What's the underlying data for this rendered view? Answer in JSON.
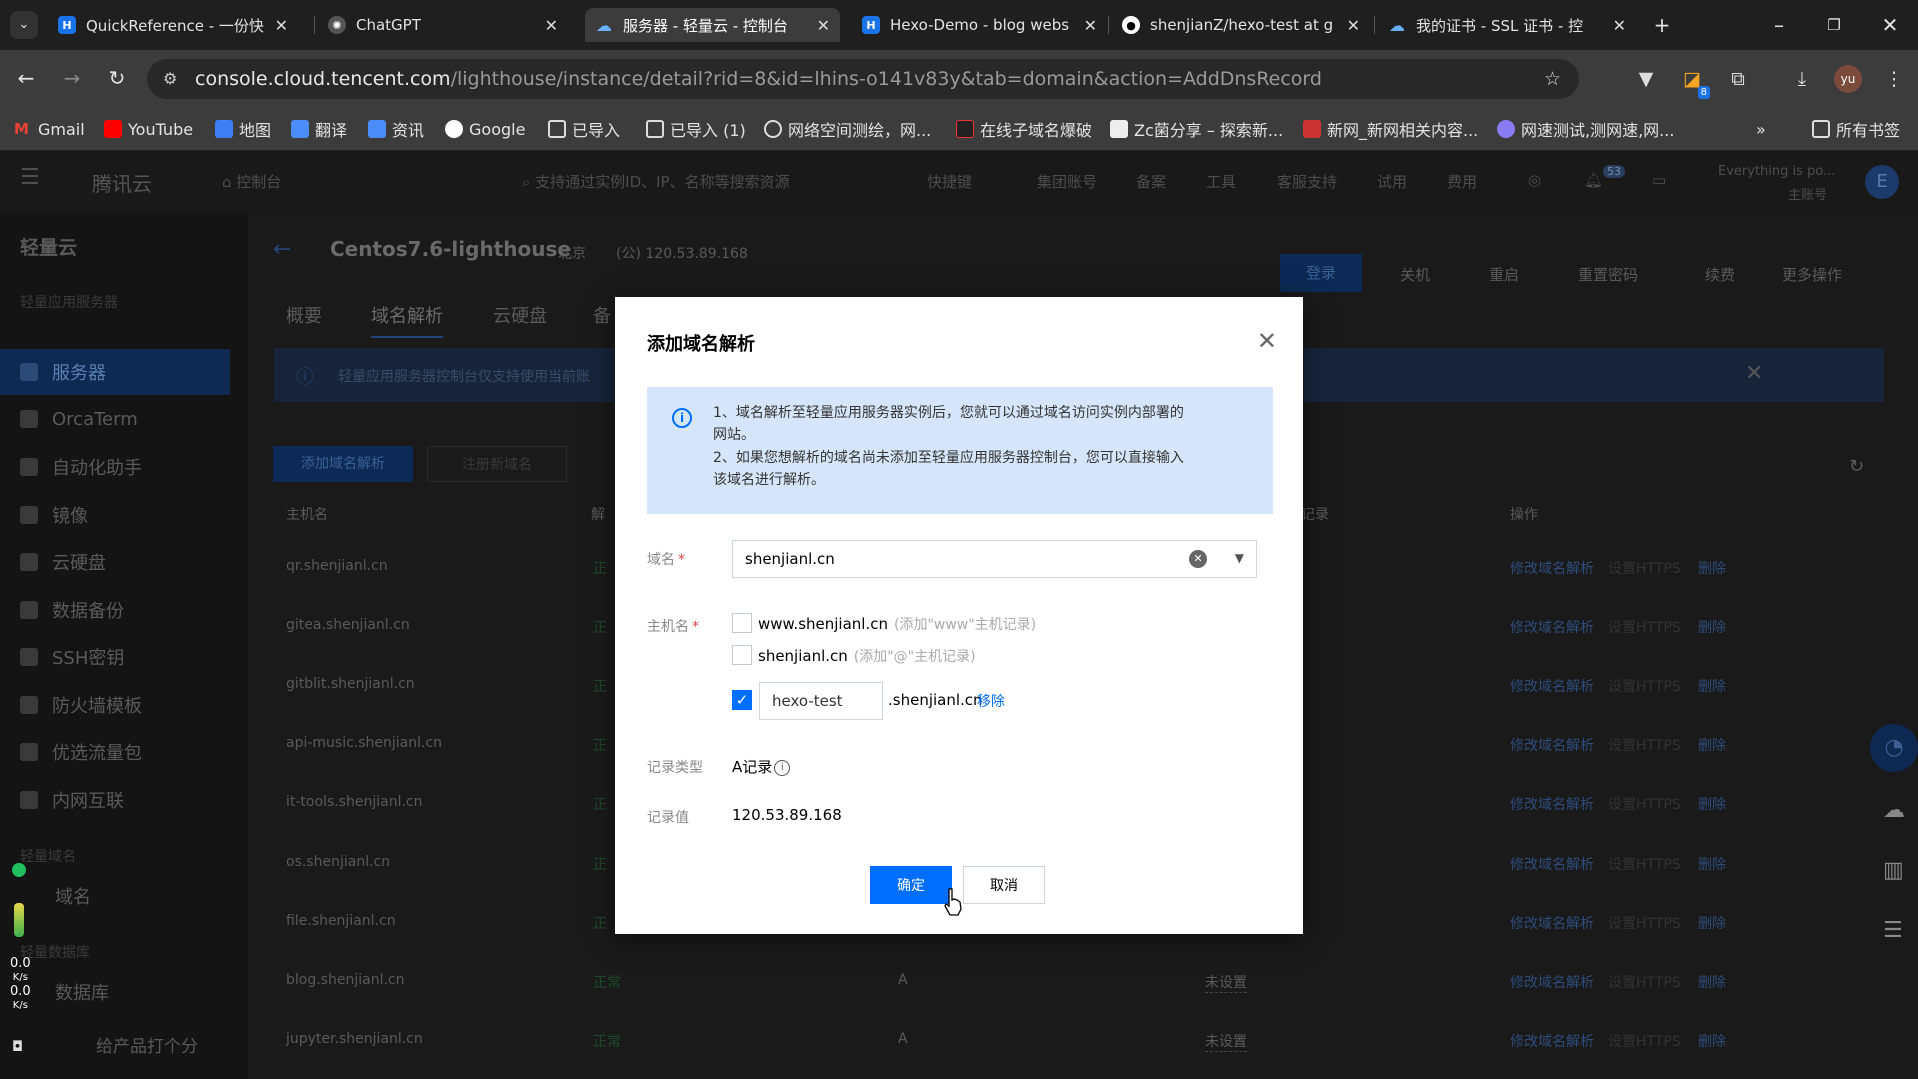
{
  "browser": {
    "tabs": [
      {
        "title": "QuickReference - 一份快",
        "favicon_color": "#1a73e8"
      },
      {
        "title": "ChatGPT",
        "favicon_color": "#777777"
      },
      {
        "title": "服务器 - 轻量云 - 控制台",
        "favicon_color": "#4ea1ff"
      },
      {
        "title": "Hexo-Demo - blog webs",
        "favicon_color": "#1a73e8"
      },
      {
        "title": "shenjianZ/hexo-test at g",
        "favicon_color": "#ffffff"
      },
      {
        "title": "我的证书 - SSL 证书 - 控",
        "favicon_color": "#4ea1ff"
      }
    ],
    "url_host": "console.cloud.tencent.com",
    "url_path": "/lighthouse/instance/detail?rid=8&id=lhins-o141v83y&tab=domain&action=AddDnsRecord",
    "profile_initials": "yu",
    "extension_badge": "8",
    "bookmarks": [
      "Gmail",
      "YouTube",
      "地图",
      "翻译",
      "资讯",
      "Google",
      "已导入",
      "已导入 (1)",
      "网络空间测绘，网...",
      "在线子域名爆破",
      "Zc菌分享 – 探索新...",
      "新网_新网相关内容...",
      "网速测试,测网速,网..."
    ],
    "all_bookmarks": "所有书签"
  },
  "console": {
    "logo": "腾讯云",
    "home": "控制台",
    "search_placeholder": "支持通过实例ID、IP、名称等搜索资源",
    "nav": [
      "快捷键",
      "集团账号",
      "备案",
      "工具",
      "客服支持",
      "试用",
      "费用"
    ],
    "notification_count": "53",
    "account_line1": "Everything is po...",
    "account_line2": "主账号",
    "avatar": "E",
    "sidebar_title": "轻量云",
    "sidebar_section1": "轻量应用服务器",
    "sidebar_items": [
      "服务器",
      "OrcaTerm",
      "自动化助手",
      "镜像",
      "云硬盘",
      "数据备份",
      "SSH密钥",
      "防火墙模板",
      "优选流量包",
      "内网互联"
    ],
    "sidebar_section2": "轻量域名",
    "sidebar_domain": "域名",
    "sidebar_section3": "轻量数据库",
    "sidebar_db": "数据库",
    "sidebar_feedback": "给产品打个分",
    "net_up": "0.0",
    "net_down": "0.0",
    "net_unit": "K/s",
    "instance_name": "Centos7.6-lighthouse",
    "region": "北京",
    "public_ip": "(公) 120.53.89.168",
    "action_buttons": [
      "登录",
      "关机",
      "重启",
      "重置密码",
      "续费",
      "更多操作"
    ],
    "tabs": [
      "概要",
      "域名解析",
      "云硬盘",
      "备"
    ],
    "notice": "轻量应用服务器控制台仅支持使用当前账",
    "btn_add_domain": "添加域名解析",
    "btn_register": "注册新域名",
    "col_host": "主机名",
    "col_status": "解",
    "col_record": "记录",
    "col_ops": "操作",
    "rows": [
      {
        "host": "qr.shenjianl.cn",
        "status": "正",
        "type": "",
        "https": ""
      },
      {
        "host": "gitea.shenjianl.cn",
        "status": "正",
        "type": "",
        "https": ""
      },
      {
        "host": "gitblit.shenjianl.cn",
        "status": "正",
        "type": "",
        "https": ""
      },
      {
        "host": "api-music.shenjianl.cn",
        "status": "正",
        "type": "",
        "https": ""
      },
      {
        "host": "it-tools.shenjianl.cn",
        "status": "正",
        "type": "",
        "https": ""
      },
      {
        "host": "os.shenjianl.cn",
        "status": "正",
        "type": "",
        "https": ""
      },
      {
        "host": "file.shenjianl.cn",
        "status": "正",
        "type": "",
        "https": ""
      },
      {
        "host": "blog.shenjianl.cn",
        "status": "正常",
        "type": "A",
        "https": "未设置"
      },
      {
        "host": "jupyter.shenjianl.cn",
        "status": "正常",
        "type": "A",
        "https": "未设置"
      }
    ],
    "row_op_edit": "修改域名解析",
    "row_op_https": "设置HTTPS",
    "row_op_delete": "删除"
  },
  "modal": {
    "title": "添加域名解析",
    "info_line1": "1、域名解析至轻量应用服务器实例后，您就可以通过域名访问实例内部署的",
    "info_line1b": "网站。",
    "info_line2": "2、如果您想解析的域名尚未添加至轻量应用服务器控制台，您可以直接输入",
    "info_line2b": "该域名进行解析。",
    "label_domain": "域名",
    "domain_value": "shenjianl.cn",
    "label_host": "主机名",
    "option1": "www.shenjianl.cn",
    "option1_hint": "(添加\"www\"主机记录)",
    "option2": "shenjianl.cn",
    "option2_hint": "(添加\"@\"主机记录)",
    "custom_host": "hexo-test",
    "custom_suffix": ".shenjianl.cn",
    "remove": "移除",
    "label_type": "记录类型",
    "type_value": "A记录",
    "label_value": "记录值",
    "record_value": "120.53.89.168",
    "ok": "确定",
    "cancel": "取消"
  },
  "colors": {
    "accent": "#006eff",
    "info_bg": "#d6e6fa",
    "required": "#e54545"
  }
}
